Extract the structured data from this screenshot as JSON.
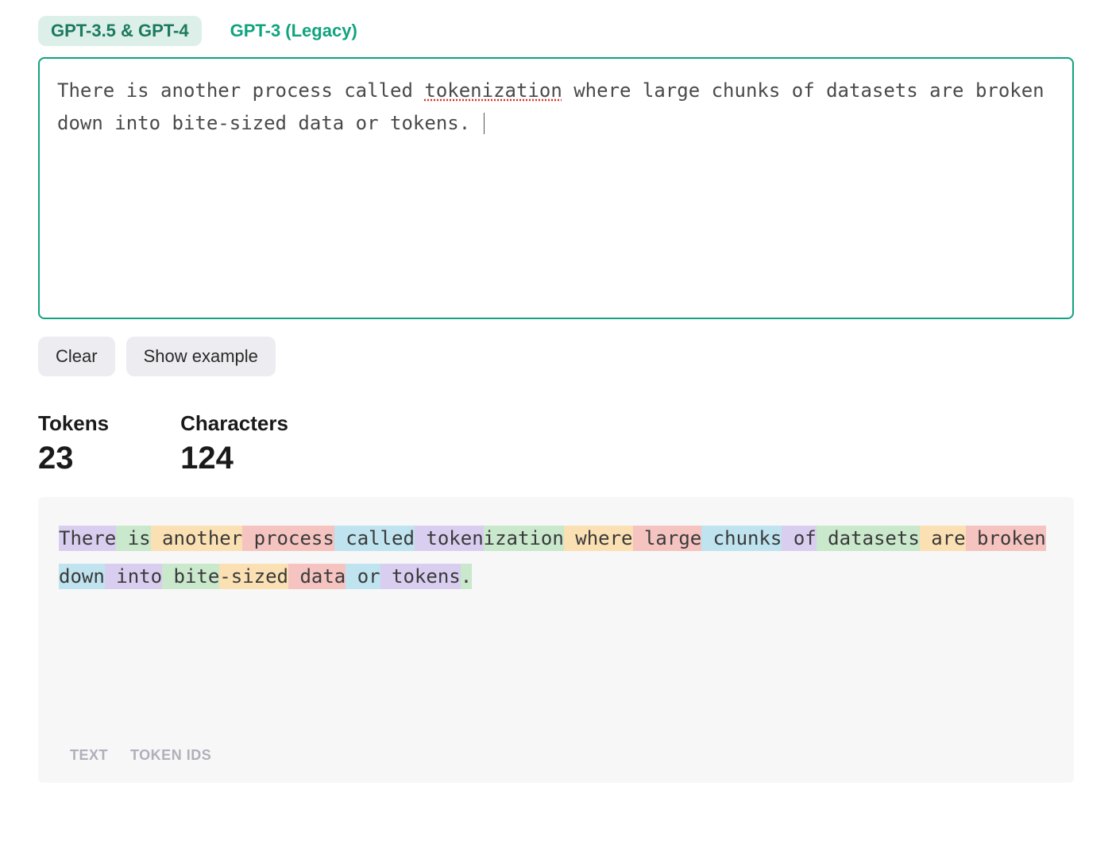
{
  "tabs": {
    "active": "GPT-3.5 & GPT-4",
    "inactive": "GPT-3 (Legacy)"
  },
  "input": {
    "before_spellerr": "There is another process called ",
    "spellerr_word": "tokenization",
    "after_spellerr": " where large chunks of datasets are broken down into bite-sized data or tokens. "
  },
  "buttons": {
    "clear": "Clear",
    "show_example": "Show example"
  },
  "stats": {
    "tokens_label": "Tokens",
    "tokens_value": "23",
    "characters_label": "Characters",
    "characters_value": "124"
  },
  "tokens": [
    {
      "t": "There",
      "c": 0
    },
    {
      "t": " is",
      "c": 1
    },
    {
      "t": " another",
      "c": 2
    },
    {
      "t": " process",
      "c": 3
    },
    {
      "t": " called",
      "c": 4
    },
    {
      "t": " token",
      "c": 0
    },
    {
      "t": "ization",
      "c": 1
    },
    {
      "t": " where",
      "c": 2
    },
    {
      "t": " large",
      "c": 3
    },
    {
      "t": " chunks",
      "c": 4
    },
    {
      "t": " of",
      "c": 0
    },
    {
      "t": " datasets",
      "c": 1
    },
    {
      "t": " are",
      "c": 2
    },
    {
      "t": " broken",
      "c": 3
    },
    {
      "t": " down",
      "c": 4
    },
    {
      "t": " into",
      "c": 0
    },
    {
      "t": " bite",
      "c": 1
    },
    {
      "t": "-sized",
      "c": 2
    },
    {
      "t": " data",
      "c": 3
    },
    {
      "t": " or",
      "c": 4
    },
    {
      "t": " tokens",
      "c": 0
    },
    {
      "t": ".",
      "c": 1
    },
    {
      "t": " ",
      "c": 2
    }
  ],
  "footer": {
    "text": "TEXT",
    "token_ids": "TOKEN IDS"
  }
}
